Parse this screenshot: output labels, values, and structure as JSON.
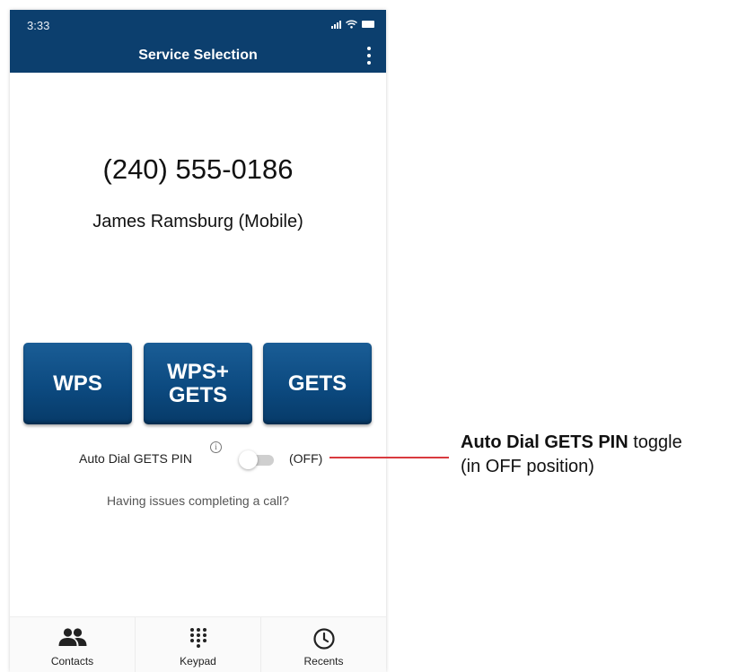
{
  "status_bar": {
    "time": "3:33"
  },
  "app_bar": {
    "title": "Service Selection"
  },
  "call": {
    "phone_number": "(240) 555-0186",
    "contact_name": "James Ramsburg (Mobile)"
  },
  "services": {
    "wps": "WPS",
    "wps_gets_line1": "WPS+",
    "wps_gets_line2": "GETS",
    "gets": "GETS"
  },
  "auto_dial": {
    "label": "Auto Dial GETS PIN",
    "info_glyph": "i",
    "state_text": "(OFF)",
    "enabled": false
  },
  "help_link": "Having issues completing a call?",
  "bottom_nav": [
    {
      "label": "Contacts",
      "icon": "contacts-icon"
    },
    {
      "label": "Keypad",
      "icon": "keypad-icon"
    },
    {
      "label": "Recents",
      "icon": "clock-icon"
    }
  ],
  "annotation": {
    "bold": "Auto Dial GETS PIN",
    "rest": " toggle",
    "line2": "(in OFF position)"
  },
  "colors": {
    "app_bar": "#0c3f6e",
    "button": "#0c4a80",
    "callout_line": "#d93a3f"
  }
}
